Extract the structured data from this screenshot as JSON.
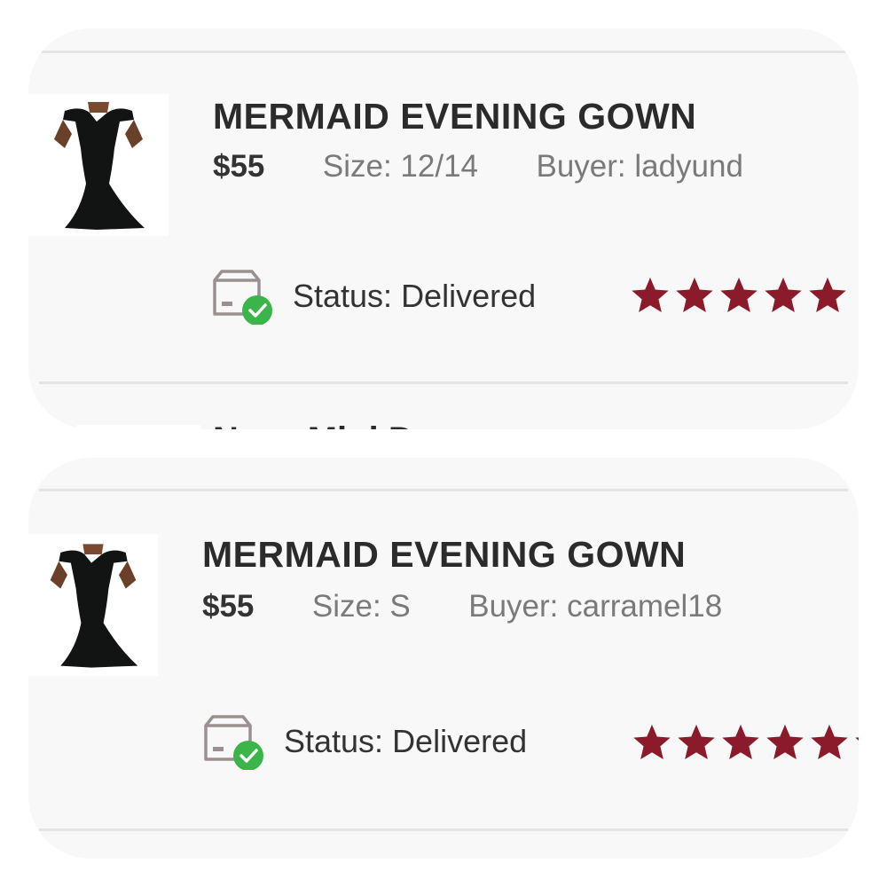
{
  "orders": [
    {
      "title": "MERMAID EVENING GOWN",
      "price": "$55",
      "size": "Size: 12/14",
      "buyer": "Buyer: ladyund",
      "status": "Status:  Delivered",
      "rating": 5,
      "image_icon": "black-mermaid-dress-photo"
    },
    {
      "title": "MERMAID EVENING GOWN",
      "price": "$55",
      "size": "Size: S",
      "buyer": "Buyer: carramel18",
      "status": "Status:  Delivered",
      "rating": 5,
      "image_icon": "black-mermaid-dress-photo"
    }
  ],
  "peek_title": "Navy Mini Dress",
  "colors": {
    "star": "#8b1a2b",
    "check_badge": "#3bb54a",
    "card_bg": "#f8f8f8",
    "divider": "#e4e4e4"
  },
  "icons": {
    "status": "delivered-box-icon",
    "rating": "star-icon"
  }
}
